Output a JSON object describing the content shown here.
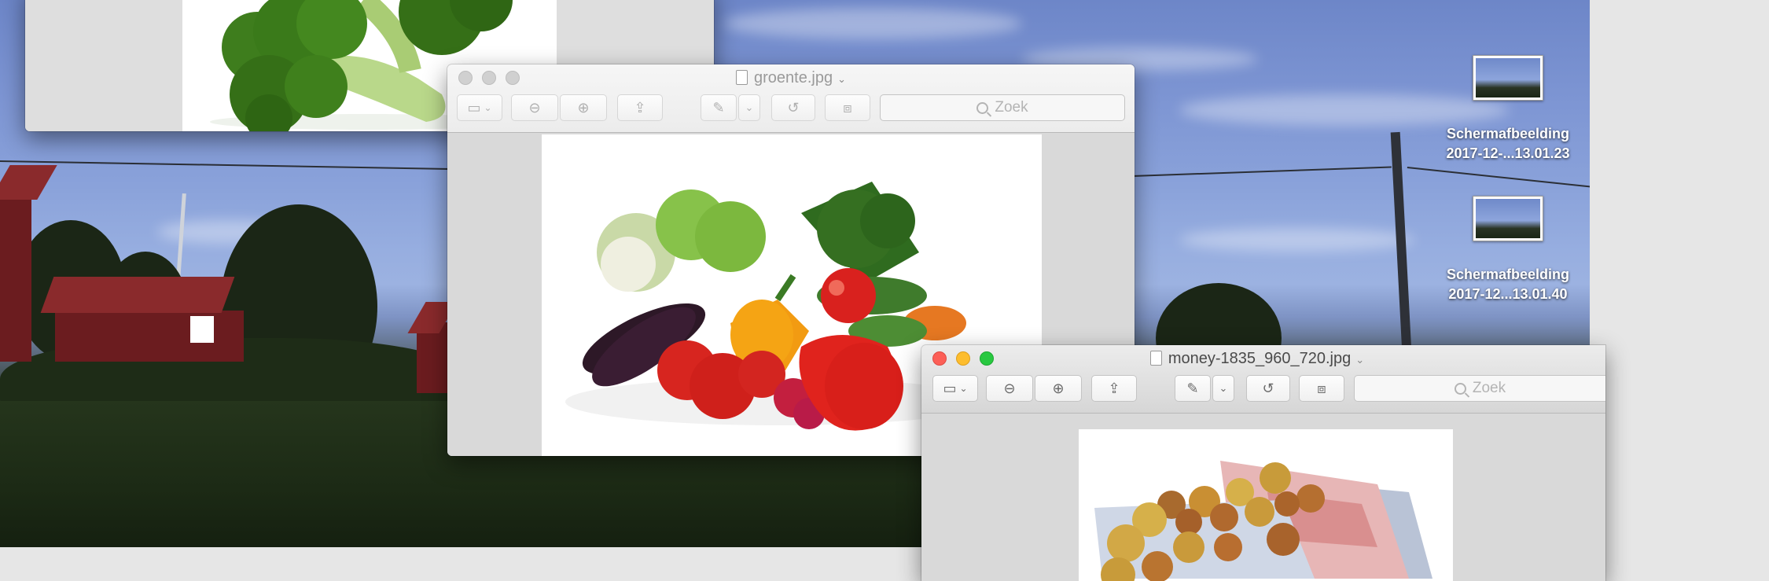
{
  "windows": {
    "broccoli": {
      "title": ""
    },
    "groente": {
      "title": "groente.jpg",
      "search_placeholder": "Zoek"
    },
    "money": {
      "title": "money-1835_960_720.jpg",
      "search_placeholder": "Zoek"
    }
  },
  "desktop_icons": [
    {
      "name_line1": "Schermafbeelding",
      "name_line2": "2017-12-...13.01.23"
    },
    {
      "name_line1": "Schermafbeelding",
      "name_line2": "2017-12...13.01.40"
    }
  ],
  "icons": [
    "sidebar-icon",
    "zoom-out-icon",
    "zoom-in-icon",
    "share-icon",
    "markup-pen-icon",
    "rotate-icon",
    "toolbox-icon",
    "search-icon",
    "document-icon"
  ],
  "colors": {
    "close": "#fc5f57",
    "minimize": "#fdbd2e",
    "zoom": "#28c840"
  }
}
